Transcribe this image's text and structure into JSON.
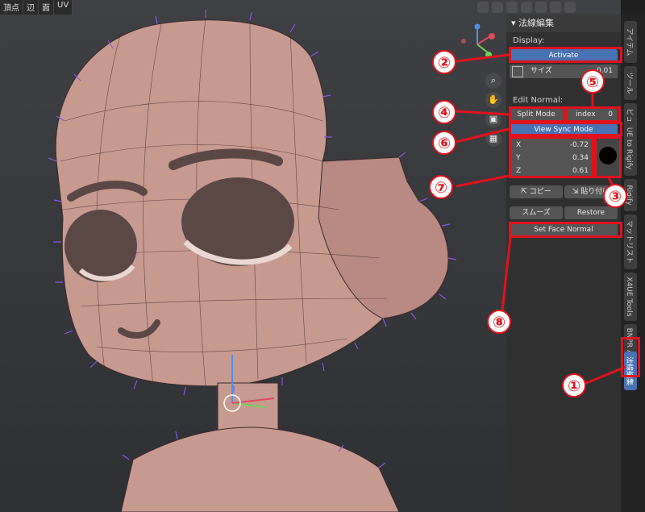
{
  "header": {
    "menu": [
      "頂点",
      "辺",
      "面",
      "UV"
    ]
  },
  "panel": {
    "title": "法線編集",
    "display_label": "Display:",
    "activate": "Activate",
    "size_label": "サイズ",
    "size_value": "0.01",
    "edit_normal_label": "Edit Normal:",
    "split_mode": "Split Mode",
    "index_label": "index",
    "index_value": "0",
    "view_sync_mode": "View Sync Mode",
    "x_label": "X",
    "x_value": "-0.72",
    "y_label": "Y",
    "y_value": "0.34",
    "z_label": "Z",
    "z_value": "0.61",
    "copy": "コピー",
    "paste": "貼り付け",
    "smooth": "スムーズ",
    "restore": "Restore",
    "set_face_normal": "Set Face Normal"
  },
  "tabs": [
    "アイテム",
    "ツール",
    "ビュー",
    "UE to Rigify",
    "Rigify",
    "マットリスト",
    "X4UE Tools",
    "BNPR Abnormal",
    "法線編集"
  ],
  "annotations": [
    "①",
    "②",
    "③",
    "④",
    "⑤",
    "⑥",
    "⑦",
    "⑧"
  ],
  "colors": {
    "accent_blue": "#4772b3",
    "annotation_red": "#e0121c",
    "skin": "#c79a90"
  }
}
